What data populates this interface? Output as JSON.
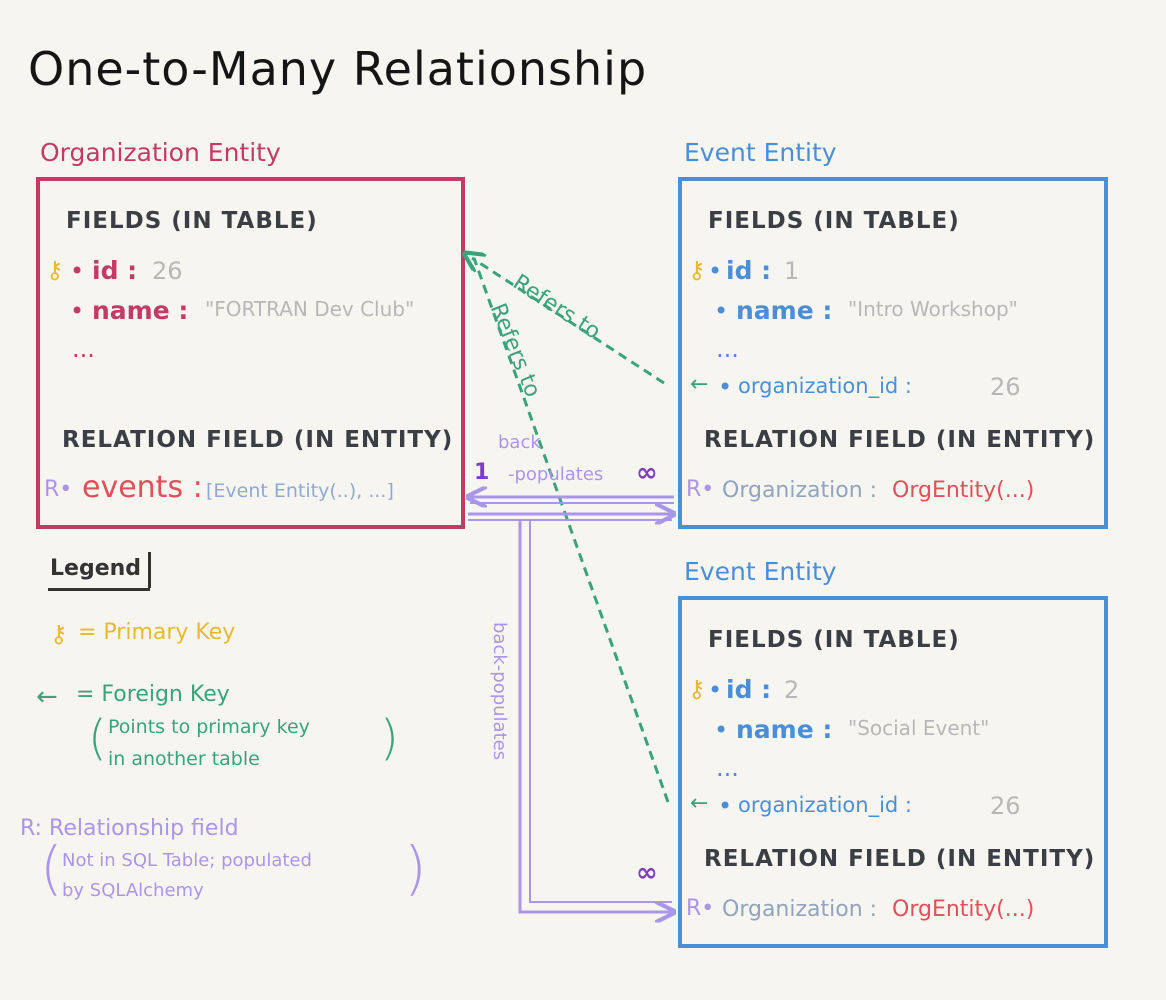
{
  "title": "One-to-Many Relationship",
  "org": {
    "label": "Organization Entity",
    "fields_header": "FIELDS (IN TABLE)",
    "key_icon": "key-icon",
    "id_name": "id",
    "id_value": "26",
    "name_name": "name",
    "name_value": "\"FORTRAN Dev Club\"",
    "ellipsis": "...",
    "relation_header": "RELATION FIELD (IN ENTITY)",
    "rel_marker": "R",
    "events_name": "events",
    "events_value": "[Event Entity(..), ...]"
  },
  "event1": {
    "label": "Event Entity",
    "fields_header": "FIELDS (IN TABLE)",
    "id_name": "id",
    "id_value": "1",
    "name_name": "name",
    "name_value": "\"Intro Workshop\"",
    "ellipsis": "...",
    "fk_name": "organization_id",
    "fk_value": "26",
    "relation_header": "RELATION FIELD (IN ENTITY)",
    "rel_marker": "R",
    "org_name": "Organization",
    "org_value": "OrgEntity(...)"
  },
  "event2": {
    "label": "Event Entity",
    "fields_header": "FIELDS (IN TABLE)",
    "id_name": "id",
    "id_value": "2",
    "name_name": "name",
    "name_value": "\"Social Event\"",
    "ellipsis": "...",
    "fk_name": "organization_id",
    "fk_value": "26",
    "relation_header": "RELATION FIELD (IN ENTITY)",
    "rel_marker": "R",
    "org_name": "Organization",
    "org_value": "OrgEntity(...)"
  },
  "arrows": {
    "refers_to_1": "Refers to",
    "refers_to_2": "Refers to",
    "back_populates_1a": "back",
    "back_populates_1b": "-populates",
    "one": "1",
    "many_1": "∞",
    "back_populates_2": "back-populates",
    "many_2": "∞"
  },
  "legend": {
    "title": "Legend",
    "pk": "= Primary Key",
    "fk": "= Foreign Key",
    "fk_note_1": "Points to primary key",
    "fk_note_2": "in another table",
    "rel": "R: Relationship field",
    "rel_note_1": "Not in SQL Table; populated",
    "rel_note_2": "by SQLAlchemy"
  },
  "colors": {
    "org": "#c23b66",
    "event": "#4a8fd6",
    "primary_key": "#e7b932",
    "foreign_key": "#3aa37a",
    "relationship": "#a996e8",
    "value_gray": "#b7b7b7",
    "orgentity_red": "#e0505a"
  }
}
